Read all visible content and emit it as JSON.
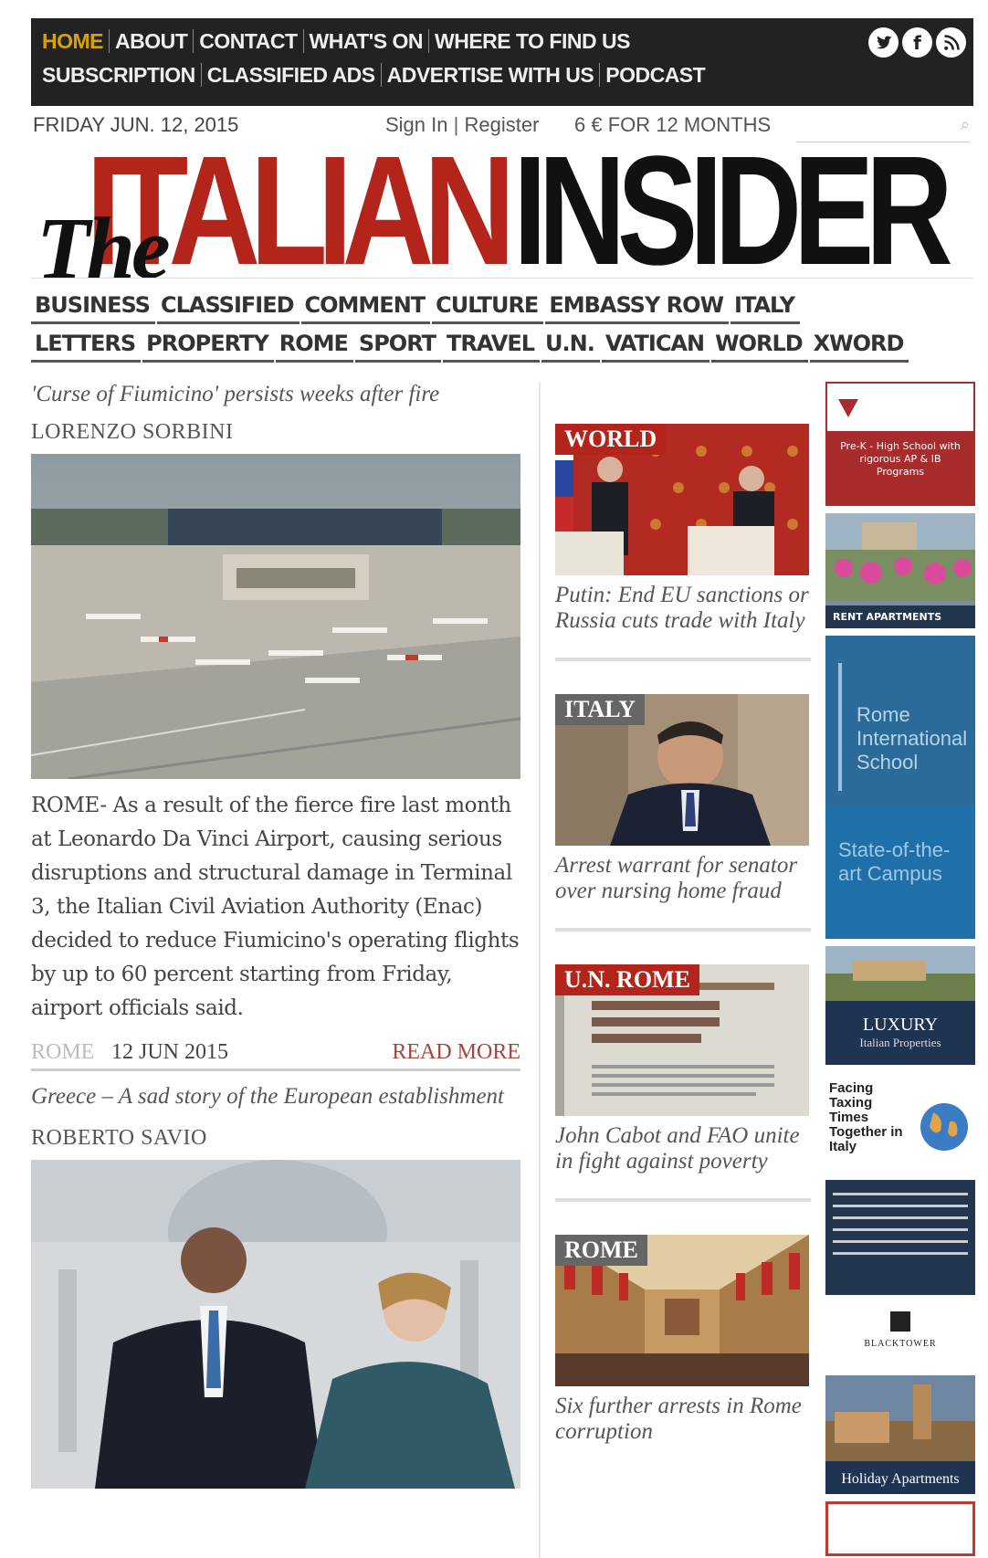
{
  "topnav": {
    "row1": [
      "HOME",
      "ABOUT",
      "CONTACT",
      "WHAT'S ON",
      "WHERE TO FIND US"
    ],
    "row2": [
      "SUBSCRIPTION",
      "CLASSIFIED ADS",
      "ADVERTISE WITH US",
      "PODCAST"
    ],
    "social": [
      "twitter-icon",
      "facebook-icon",
      "rss-icon"
    ]
  },
  "header": {
    "date": "FRIDAY JUN. 12, 2015",
    "sign_in": "Sign In",
    "separator": "|",
    "register": "Register",
    "promo": "6 € FOR 12 MONTHS",
    "search_placeholder": ""
  },
  "masthead": {
    "the": "The",
    "italian": "ITALIAN",
    "insider": "INSIDER"
  },
  "sections": {
    "row1": [
      "BUSINESS",
      "CLASSIFIED",
      "COMMENT",
      "CULTURE",
      "EMBASSY ROW",
      "ITALY"
    ],
    "row2": [
      "LETTERS",
      "PROPERTY",
      "ROME",
      "SPORT",
      "TRAVEL",
      "U.N.",
      "VATICAN",
      "WORLD",
      "XWORD"
    ]
  },
  "lead_article": {
    "title": "'Curse of Fiumicino' persists weeks after fire",
    "author": "LORENZO SORBINI",
    "body": "ROME- As a result of the fierce fire last month at Leonardo Da Vinci Airport, causing serious disruptions and structural damage in Terminal 3, the Italian Civil Aviation Authority (Enac)  decided to reduce Fiumicino's operating flights by up to 60 percent starting from Friday, airport officials said.",
    "category": "ROME",
    "date": "12 JUN 2015",
    "read_more": "READ MORE"
  },
  "second_article": {
    "title": "Greece – A sad story of the European establishment",
    "author": "ROBERTO SAVIO"
  },
  "side_stories": [
    {
      "tag": "WORLD",
      "title": "Putin: End EU sanctions or Russia cuts trade with Italy",
      "color": "#b3241a"
    },
    {
      "tag": "ITALY",
      "title": "Arrest warrant for senator over nursing home fraud",
      "color": "#666666"
    },
    {
      "tag": "U.N. ROME",
      "title": "John Cabot and FAO unite in fight against poverty",
      "color": "#b3241a"
    },
    {
      "tag": "ROME",
      "title": "Six further arrests in Rome corruption",
      "color": "#666666"
    }
  ],
  "ads": {
    "ad1": "Pre-K - High School with rigorous AP & IB Programs",
    "ad2": "RENT APARTMENTS",
    "ad3a": "Rome International School",
    "ad3b": "State-of-the-art Campus",
    "ad4": "LUXURY",
    "ad4b": "Italian Properties",
    "ad5": "Facing Taxing Times Together in Italy",
    "ad7": "BLACKTOWER",
    "ad8": "Holiday Apartments"
  }
}
